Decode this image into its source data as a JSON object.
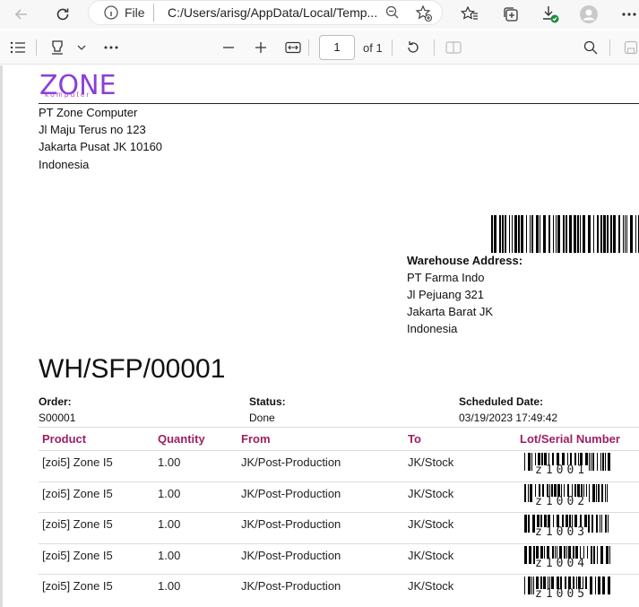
{
  "browser": {
    "scheme_label": "File",
    "url": "C:/Users/arisg/AppData/Local/Temp..."
  },
  "pdf_toolbar": {
    "page_current": "1",
    "page_total": "of 1"
  },
  "document": {
    "logo": {
      "main": "ZONE",
      "sub": "komputer"
    },
    "company": {
      "name": "PT Zone Computer",
      "street": "Jl Maju Terus no 123",
      "city": "Jakarta Pusat JK 10160",
      "country": "Indonesia"
    },
    "warehouse": {
      "label": "Warehouse Address:",
      "name": "PT Farma Indo",
      "street": "Jl Pejuang 321",
      "city": "Jakarta Barat JK",
      "country": "Indonesia"
    },
    "reference": "WH/SFP/00001",
    "order": {
      "label": "Order:",
      "value": "S00001"
    },
    "status": {
      "label": "Status:",
      "value": "Done"
    },
    "scheduled": {
      "label": "Scheduled Date:",
      "value": "03/19/2023 17:49:42"
    },
    "columns": [
      "Product",
      "Quantity",
      "From",
      "To",
      "Lot/Serial Number"
    ],
    "rows": [
      {
        "product": "[zoi5] Zone I5",
        "qty": "1.00",
        "from": "JK/Post-Production",
        "to": "JK/Stock",
        "lot": "z1001"
      },
      {
        "product": "[zoi5] Zone I5",
        "qty": "1.00",
        "from": "JK/Post-Production",
        "to": "JK/Stock",
        "lot": "z1002"
      },
      {
        "product": "[zoi5] Zone I5",
        "qty": "1.00",
        "from": "JK/Post-Production",
        "to": "JK/Stock",
        "lot": "z1003"
      },
      {
        "product": "[zoi5] Zone I5",
        "qty": "1.00",
        "from": "JK/Post-Production",
        "to": "JK/Stock",
        "lot": "z1004"
      },
      {
        "product": "[zoi5] Zone I5",
        "qty": "1.00",
        "from": "JK/Post-Production",
        "to": "JK/Stock",
        "lot": "z1005"
      }
    ]
  },
  "colors": {
    "logo": "#8a3fd9",
    "column_header": "#9e1f62"
  }
}
